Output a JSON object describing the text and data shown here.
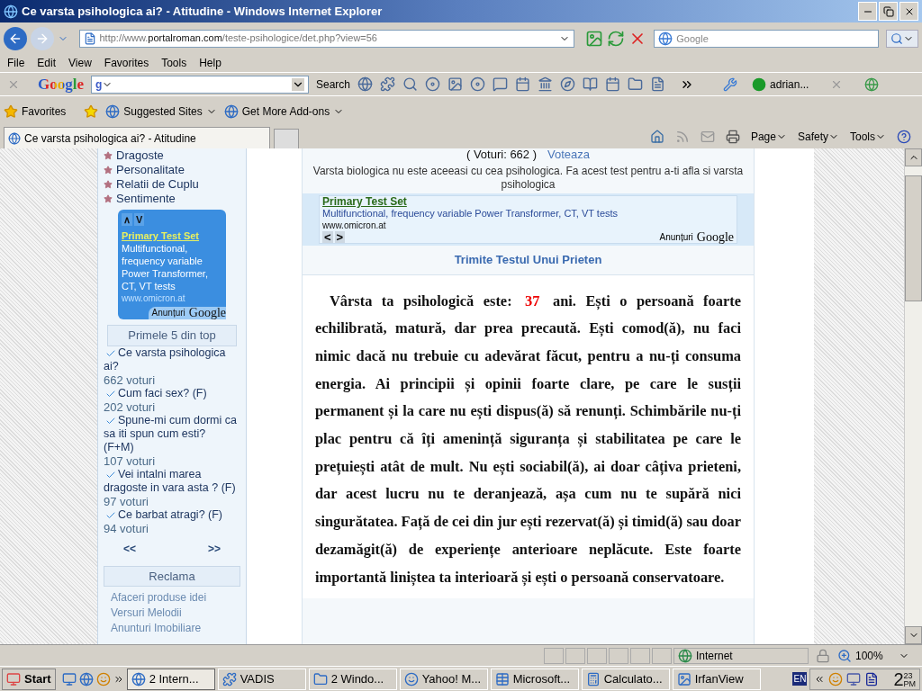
{
  "window": {
    "title": "Ce varsta psihologica ai? - Atitudine - Windows Internet Explorer"
  },
  "address_bar": {
    "url": "http://www.**portalroman.com**/teste-psihologice/det.php?view=56"
  },
  "search_box": {
    "placeholder": "Google"
  },
  "menu": [
    "File",
    "Edit",
    "View",
    "Favorites",
    "Tools",
    "Help"
  ],
  "google_toolbar": {
    "logo": "Google",
    "engine_mark": "g",
    "search_label": "Search",
    "user": "adrian..."
  },
  "favorites_bar": {
    "label": "Favorites",
    "links": [
      "Suggested Sites",
      "Get More Add-ons"
    ]
  },
  "tabs": [
    {
      "label": "Ce varsta psihologica ai? - Atitudine",
      "selected": true
    }
  ],
  "command_bar": [
    "Page",
    "Safety",
    "Tools"
  ],
  "sidebar": {
    "categories": [
      "Dragoste",
      "Personalitate",
      "Relatii de Cuplu",
      "Sentimente"
    ],
    "ad": {
      "nav": [
        "∧",
        "V"
      ],
      "title": "Primary Test Set",
      "text": "Multifunctional, frequency variable Power Transformer, CT, VT tests",
      "url": "www.omicron.at",
      "label": "Anunțuri",
      "brand": "Google"
    },
    "top_heading": "Primele 5 din top",
    "top_items": [
      {
        "title": "Ce varsta psihologica ai?",
        "votes": "662 voturi"
      },
      {
        "title": "Cum faci sex? (F)",
        "votes": "202 voturi"
      },
      {
        "title": "Spune-mi cum dormi ca sa iti spun cum esti? (F+M)",
        "votes": "107 voturi"
      },
      {
        "title": "Vei intalni marea dragoste in vara asta ? (F)",
        "votes": "97 voturi"
      },
      {
        "title": "Ce barbat atragi? (F)",
        "votes": "94 voturi"
      }
    ],
    "prev": "<<",
    "next": ">>",
    "ads_heading": "Reclama",
    "ad_links": [
      "Afaceri produse idei",
      "Versuri Melodii",
      "Anunturi Imobiliare"
    ]
  },
  "main": {
    "votes": "( Voturi: 662 )",
    "vote_link": "Voteaza",
    "description": "Varsta biologica nu este aceeasi cu cea psihologica. Fa acest test pentru a-ti afla si varsta psihologica",
    "ad": {
      "title": "Primary Test Set",
      "text": "Multifunctional, frequency variable Power Transformer, CT, VT tests",
      "url": "www.omicron.at",
      "nav": [
        "<",
        ">"
      ],
      "label": "Anunțuri",
      "brand": "Google"
    },
    "send_link": "Trimite Testul Unui Prieten",
    "result": {
      "before": "Vârsta ta psihologică este:",
      "age": "37",
      "after": "ani. Ești o persoană foarte echilibrată, matură, dar prea precaută. Ești comod(ă), nu faci nimic dacă nu trebuie cu adevărat făcut, pentru a nu-ți consuma energia. Ai principii și opinii foarte clare, pe care le susții permanent și la care nu ești dispus(ă) să renunți. Schimbările nu-ți plac pentru că îți amenință siguranța și stabilitatea pe care le prețuiești atât de mult. Nu ești sociabil(ă), ai doar câțiva prieteni, dar acest lucru nu te deranjează, așa cum nu te supără nici singurătatea. Față de cei din jur ești rezervat(ă) și timid(ă) sau doar dezamăgit(ă) de experiențe anterioare neplăcute. Este foarte importantă liniștea ta interioară și ești o persoană conservatoare."
    }
  },
  "status_bar": {
    "zone": "Internet",
    "zoom": "100%"
  },
  "taskbar": {
    "start": "Start",
    "buttons": [
      {
        "label": "2 Intern...",
        "selected": true
      },
      {
        "label": "VADIS",
        "selected": false
      },
      {
        "label": "2 Windo...",
        "selected": false
      },
      {
        "label": "Yahoo! M...",
        "selected": false
      },
      {
        "label": "Microsoft...",
        "selected": false
      },
      {
        "label": "Calculato...",
        "selected": false
      },
      {
        "label": "IrfanView",
        "selected": false
      }
    ],
    "language": "EN",
    "time_hour": "2",
    "time_minutes": "23",
    "time_period": "PM"
  }
}
